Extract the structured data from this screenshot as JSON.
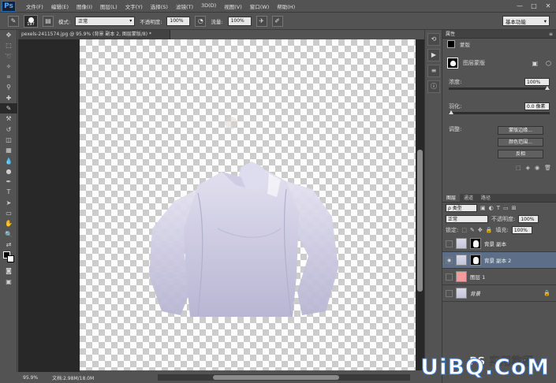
{
  "app": {
    "logo": "Ps"
  },
  "menu": [
    "文件(F)",
    "编辑(E)",
    "图像(I)",
    "图层(L)",
    "文字(Y)",
    "选择(S)",
    "滤镜(T)",
    "3D(D)",
    "视图(V)",
    "窗口(W)",
    "帮助(H)"
  ],
  "window_controls": [
    "—",
    "□",
    "✕"
  ],
  "options": {
    "brush_size": "197",
    "mode_label": "模式:",
    "mode_value": "正常",
    "opacity_label": "不透明度:",
    "opacity_value": "100%",
    "flow_label": "流量:",
    "flow_value": "100%",
    "workspace": "基本功能"
  },
  "document": {
    "tab_title": "pexels-2411574.jpg @ 95.9% (背景 副本 2, 图层蒙版/8) *",
    "zoom": "95.9%",
    "doc_size": "文档:2.98M/18.0M"
  },
  "properties": {
    "title": "属性",
    "mask_type": "蒙版",
    "layer_mask_label": "图层蒙版",
    "density_label": "浓度:",
    "density_value": "100%",
    "feather_label": "羽化:",
    "feather_value": "0.0 像素",
    "adjust_label": "调整:",
    "btn_edge": "蒙版边缘...",
    "btn_color_range": "颜色范围...",
    "btn_invert": "反相"
  },
  "layers": {
    "tabs": [
      "图层",
      "通道",
      "路径"
    ],
    "filter": "ρ 类型",
    "blend_mode": "正常",
    "opacity_label": "不透明度:",
    "opacity_value": "100%",
    "lock_label": "锁定:",
    "fill_label": "填充:",
    "fill_value": "100%",
    "items": [
      {
        "name": "背景 副本",
        "visible": false,
        "selected": false
      },
      {
        "name": "背景 副本 2",
        "visible": true,
        "selected": true
      },
      {
        "name": "图层 1",
        "visible": false,
        "selected": false
      },
      {
        "name": "背景",
        "visible": false,
        "selected": false
      }
    ]
  },
  "watermark": {
    "brand": "UiBQ.CoM",
    "sub": "PS 实用教程"
  }
}
